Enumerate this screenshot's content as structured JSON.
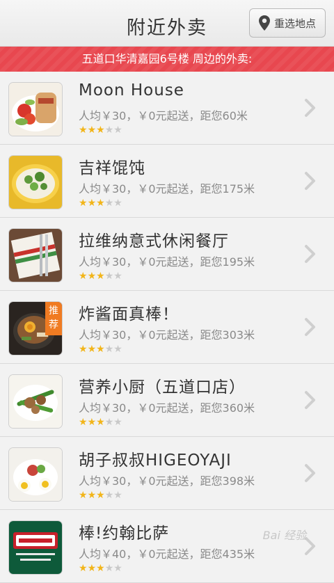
{
  "header": {
    "title": "附近外卖",
    "relocate_label": "重选地点"
  },
  "banner": {
    "text": "五道口华清嘉园6号楼 周边的外卖:"
  },
  "restaurants": [
    {
      "name": "Moon House",
      "info": "人均￥30，￥0元起送，距您60米",
      "rating": 3,
      "max_rating": 5,
      "tag": ""
    },
    {
      "name": "吉祥馄饨",
      "info": "人均￥30，￥0元起送，距您175米",
      "rating": 3,
      "max_rating": 5,
      "tag": ""
    },
    {
      "name": "拉维纳意式休闲餐厅",
      "info": "人均￥30，￥0元起送，距您195米",
      "rating": 3,
      "max_rating": 5,
      "tag": ""
    },
    {
      "name": "炸酱面真棒！",
      "info": "人均￥30，￥0元起送，距您303米",
      "rating": 3,
      "max_rating": 5,
      "tag": "推荐"
    },
    {
      "name": "营养小厨（五道口店）",
      "info": "人均￥30，￥0元起送，距您360米",
      "rating": 3,
      "max_rating": 5,
      "tag": ""
    },
    {
      "name": "胡子叔叔HIGEOYAJI",
      "info": "人均￥30，￥0元起送，距您398米",
      "rating": 3,
      "max_rating": 5,
      "tag": ""
    },
    {
      "name": "棒!约翰比萨",
      "info": "人均￥40，￥0元起送，距您435米",
      "rating": 3,
      "max_rating": 5,
      "tag": ""
    }
  ],
  "colors": {
    "banner_bg": "#e8474f",
    "star_on": "#f2b51a",
    "star_off": "#c9c9c9",
    "tag_bg": "#f07b22"
  },
  "watermark": "Bai 经验"
}
